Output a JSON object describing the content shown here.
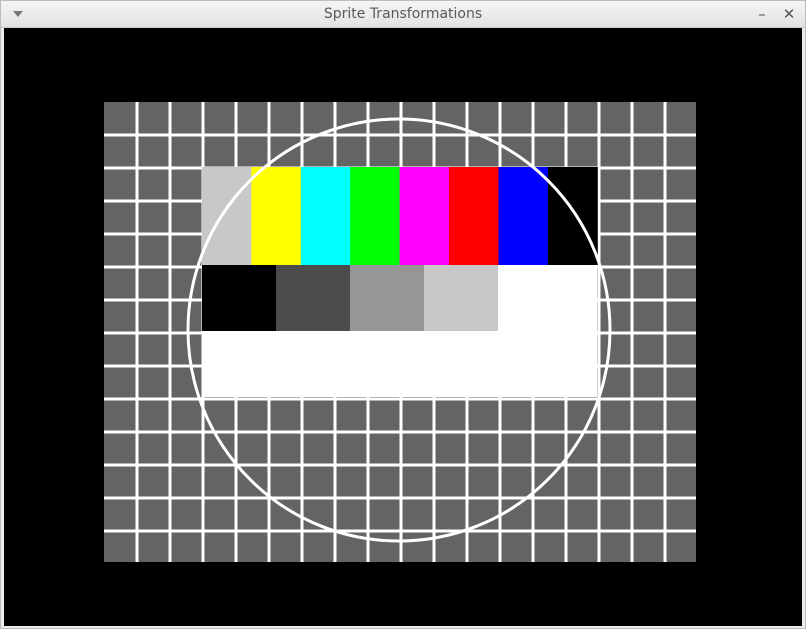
{
  "window": {
    "title": "Sprite Transformations",
    "menu_icon": "chevron-down-icon",
    "minimize_label": "–",
    "close_label": "✕"
  },
  "test_pattern": {
    "background_color": "#000000",
    "grid_background_color": "#646464",
    "grid_line_color": "#ffffff",
    "circle_color": "#ffffff",
    "color_bars": [
      "#c8c8c8",
      "#ffff00",
      "#00ffff",
      "#00ff00",
      "#ff00ff",
      "#ff0000",
      "#0000ff",
      "#000000"
    ],
    "gray_steps": [
      "#000000",
      "#4c4c4c",
      "#969696",
      "#c8c8c8",
      "#ffffff"
    ],
    "lower_band_color": "#ffffff"
  }
}
